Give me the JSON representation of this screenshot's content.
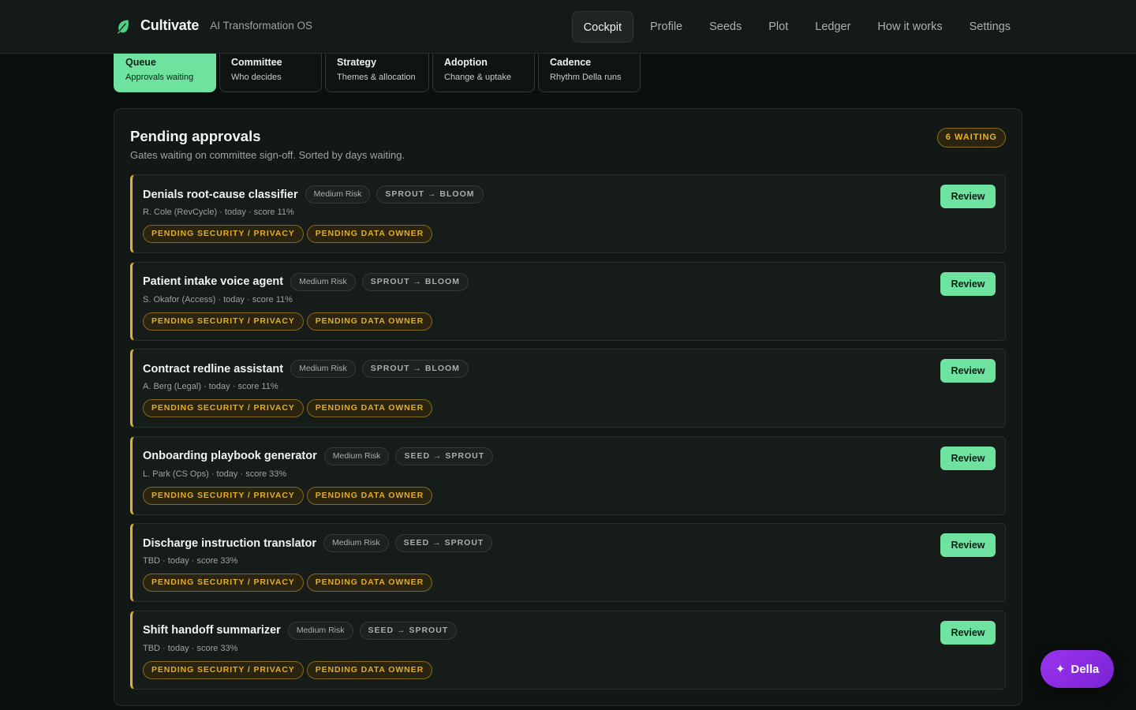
{
  "header": {
    "brand_name": "Cultivate",
    "brand_tagline": "AI Transformation OS",
    "logo_icon": "leaf-icon",
    "nav": [
      {
        "label": "Cockpit",
        "active": true
      },
      {
        "label": "Profile",
        "active": false
      },
      {
        "label": "Seeds",
        "active": false
      },
      {
        "label": "Plot",
        "active": false
      },
      {
        "label": "Ledger",
        "active": false
      },
      {
        "label": "How it works",
        "active": false
      },
      {
        "label": "Settings",
        "active": false
      }
    ]
  },
  "subtabs": [
    {
      "title": "Queue",
      "subtitle": "Approvals waiting",
      "active": true
    },
    {
      "title": "Committee",
      "subtitle": "Who decides",
      "active": false
    },
    {
      "title": "Strategy",
      "subtitle": "Themes & allocation",
      "active": false
    },
    {
      "title": "Adoption",
      "subtitle": "Change & uptake",
      "active": false
    },
    {
      "title": "Cadence",
      "subtitle": "Rhythm Della runs",
      "active": false
    }
  ],
  "panel": {
    "title": "Pending approvals",
    "subtitle": "Gates waiting on committee sign-off. Sorted by days waiting.",
    "badge": "6 WAITING"
  },
  "approvals": [
    {
      "title": "Denials root-cause classifier",
      "risk": "Medium Risk",
      "stage": "SPROUT → BLOOM",
      "meta": "R. Cole (RevCycle) · today · score 11%",
      "tags": [
        "PENDING SECURITY / PRIVACY",
        "PENDING DATA OWNER"
      ],
      "action": "Review"
    },
    {
      "title": "Patient intake voice agent",
      "risk": "Medium Risk",
      "stage": "SPROUT → BLOOM",
      "meta": "S. Okafor (Access) · today · score 11%",
      "tags": [
        "PENDING SECURITY / PRIVACY",
        "PENDING DATA OWNER"
      ],
      "action": "Review"
    },
    {
      "title": "Contract redline assistant",
      "risk": "Medium Risk",
      "stage": "SPROUT → BLOOM",
      "meta": "A. Berg (Legal) · today · score 11%",
      "tags": [
        "PENDING SECURITY / PRIVACY",
        "PENDING DATA OWNER"
      ],
      "action": "Review"
    },
    {
      "title": "Onboarding playbook generator",
      "risk": "Medium Risk",
      "stage": "SEED → SPROUT",
      "meta": "L. Park (CS Ops) · today · score 33%",
      "tags": [
        "PENDING SECURITY / PRIVACY",
        "PENDING DATA OWNER"
      ],
      "action": "Review"
    },
    {
      "title": "Discharge instruction translator",
      "risk": "Medium Risk",
      "stage": "SEED → SPROUT",
      "meta": "TBD · today · score 33%",
      "tags": [
        "PENDING SECURITY / PRIVACY",
        "PENDING DATA OWNER"
      ],
      "action": "Review"
    },
    {
      "title": "Shift handoff summarizer",
      "risk": "Medium Risk",
      "stage": "SEED → SPROUT",
      "meta": "TBD · today · score 33%",
      "tags": [
        "PENDING SECURITY / PRIVACY",
        "PENDING DATA OWNER"
      ],
      "action": "Review"
    }
  ],
  "assistant": {
    "label": "Della",
    "icon": "sparkle-icon"
  },
  "colors": {
    "accent": "#6ee29f",
    "warning": "#e5b22a",
    "assistant": "#8a2be2"
  }
}
